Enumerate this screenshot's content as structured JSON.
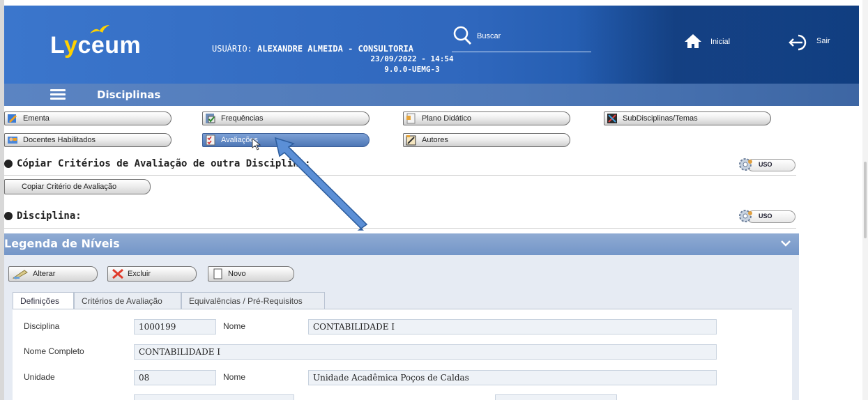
{
  "header": {
    "logo": {
      "pre": "L",
      "y": "y",
      "post": "ceum"
    },
    "user_label": "USUÁRIO:",
    "user_name": "ALEXANDRE ALMEIDA - CONSULTORIA",
    "datetime": "23/09/2022 - 14:54",
    "version": "9.0.0-UEMG-3",
    "search_label": "Buscar",
    "home_label": "Inicial",
    "exit_label": "Sair",
    "icons": {
      "search": "search-icon",
      "home": "home-icon",
      "exit": "exit-icon"
    }
  },
  "subheader": {
    "title": "Disciplinas",
    "menu_icon": "hamburger-icon"
  },
  "nav": {
    "ementa": "Ementa",
    "frequencias": "Frequências",
    "plano": "Plano Didático",
    "subdisciplinas": "SubDisciplinas/Temas",
    "docentes": "Docentes Habilitados",
    "avaliacoes": "Avaliações",
    "autores": "Autores"
  },
  "copy_section": {
    "title": "Cópiar Critérios de Avaliação de outra Disciplina:",
    "button": "Copiar Critério de Avaliação",
    "uso": "USO"
  },
  "disciplina_section": {
    "title": "Disciplina:",
    "uso": "USO"
  },
  "legend": {
    "title": "Legenda de Níveis"
  },
  "actions": {
    "alterar": "Alterar",
    "excluir": "Excluir",
    "novo": "Novo"
  },
  "tabs": {
    "definicoes": "Definições",
    "criterios": "Critérios de Avaliação",
    "equivalencias": "Equivalências / Pré-Requisitos"
  },
  "form": {
    "disciplina_label": "Disciplina",
    "disciplina_value": "1000199",
    "nome_label": "Nome",
    "nome_value": "CONTABILIDADE I",
    "nome_completo_label": "Nome Completo",
    "nome_completo_value": "CONTABILIDADE I",
    "unidade_label": "Unidade",
    "unidade_value": "08",
    "unidade_nome_label": "Nome",
    "unidade_nome_value": "Unidade Acadêmica Poços de Caldas"
  },
  "colors": {
    "header_blue": "#2f67bd",
    "arrow": "#5b8fd6"
  }
}
